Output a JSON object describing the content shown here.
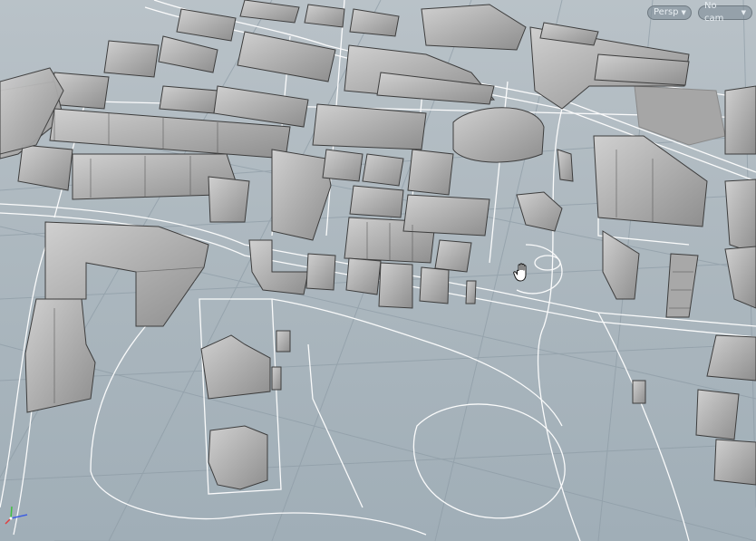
{
  "viewport": {
    "view_menu_label": "Persp",
    "camera_menu_label": "No cam",
    "dropdown_icon": "triangle-down-icon",
    "cursor_icon": "hand-pan-icon",
    "gizmo_icon": "xyz-axis-icon"
  },
  "colors": {
    "background_top": "#b9c2c8",
    "background_bottom": "#a0aeb7",
    "grid": "#8e9ca6",
    "roads": "#ffffff",
    "building_top": "#c8c8c8",
    "building_side": "#8a8a8a",
    "building_edge": "#404040",
    "axis_x": "#e04040",
    "axis_y": "#40c040",
    "axis_z": "#4060e0"
  }
}
